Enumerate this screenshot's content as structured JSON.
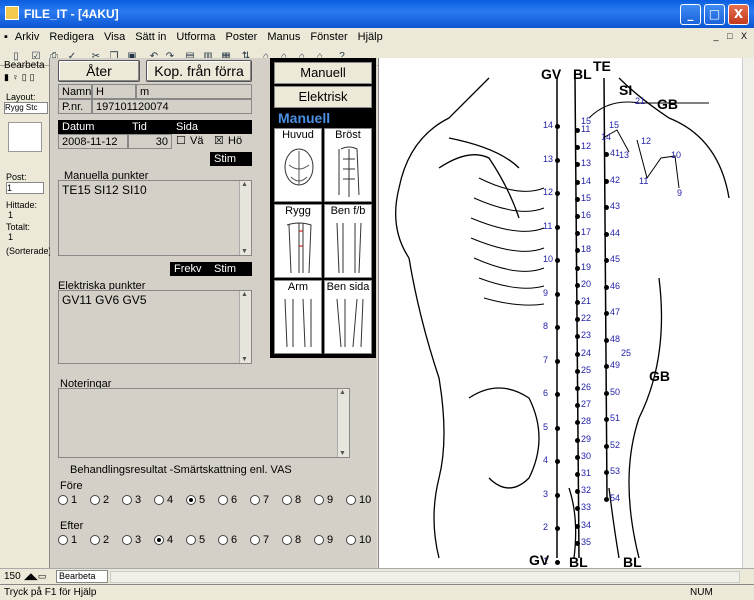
{
  "window": {
    "title": "FILE_IT - [4AKU]",
    "minimize": "_",
    "maximize": "□",
    "close": "X"
  },
  "menu": {
    "items": [
      "Arkiv",
      "Redigera",
      "Visa",
      "Sätt in",
      "Utforma",
      "Poster",
      "Manus",
      "Fönster",
      "Hjälp"
    ],
    "mdi_controls": "_ □ X"
  },
  "left_panel": {
    "tab": "Bearbeta",
    "layout_label": "Layout:",
    "layout_value": "Rygg Stc",
    "post_label": "Post:",
    "post_value": "1",
    "hittade_label": "Hittade:",
    "hittade_value": "1",
    "totalt_label": "Totalt:",
    "totalt_value": "1",
    "sorted": "(Sorterade)"
  },
  "form": {
    "back_button": "Åter",
    "copy_button": "Kop. från förra",
    "namn_label": "Namn",
    "namn_value": "H",
    "namn_value2": "m",
    "pnr_label": "P.nr.",
    "pnr_value": "197101120074",
    "datum_label": "Datum",
    "tid_label": "Tid",
    "sida_label": "Sida",
    "datum_value": "2008-11-12",
    "tid_value": "30",
    "va_label": "Vä",
    "ho_label": "Hö",
    "ho_checked": "☒",
    "va_checked": "☐",
    "stim_label": "Stim",
    "manuella_label": "Manuella punkter",
    "manuella_value": "TE15 SI12 SI10",
    "frekv_label": "Frekv",
    "stim2_label": "Stim",
    "elektriska_label": "Elektriska punkter",
    "elektriska_value": "GV11 GV6 GV5",
    "noteringar_label": "Noteringar",
    "result_label": "Behandlingsresultat -Smärtskattning enl. VAS",
    "fore_label": "Före",
    "efter_label": "Efter",
    "scale": [
      "1",
      "2",
      "3",
      "4",
      "5",
      "6",
      "7",
      "8",
      "9",
      "10"
    ],
    "fore_selected": 5,
    "efter_selected": 4
  },
  "body_panel": {
    "manuell_button": "Manuell",
    "elektrisk_button": "Elektrisk",
    "mode_label": "Manuell",
    "regions": [
      "Huvud",
      "Bröst",
      "Rygg",
      "Ben f/b",
      "Arm",
      "Ben sida"
    ]
  },
  "drawing": {
    "labels": {
      "gv_top": "GV",
      "bl_top": "BL",
      "te": "TE",
      "si": "SI",
      "gb_top": "GB",
      "gb_side": "GB",
      "gv_bottom": "GV",
      "bl_bottom1": "BL",
      "bl_bottom2": "BL",
      "n21": "21",
      "n25": "25",
      "n15a": "15",
      "n14a": "14",
      "n13a": "13",
      "n12a": "12",
      "n11a": "11",
      "n10a": "10",
      "n9a": "9",
      "n15b": "15"
    },
    "gv_points": [
      "14",
      "13",
      "12",
      "11",
      "10",
      "9",
      "8",
      "7",
      "6",
      "5",
      "4",
      "3",
      "2",
      "1"
    ],
    "bl_inner": [
      "11",
      "12",
      "13",
      "14",
      "15",
      "16",
      "17",
      "18",
      "19",
      "20",
      "21",
      "22",
      "23",
      "24",
      "25",
      "26",
      "27",
      "28",
      "29",
      "30",
      "31",
      "32",
      "33",
      "34",
      "35"
    ],
    "bl_outer": [
      "41",
      "42",
      "43",
      "44",
      "45",
      "46",
      "47",
      "48",
      "49",
      "50",
      "51",
      "52",
      "53",
      "54"
    ]
  },
  "bottom_bar": {
    "zoom": "150",
    "mode": "Bearbeta"
  },
  "status": {
    "text": "Tryck på F1 för Hjälp",
    "num": "NUM"
  }
}
